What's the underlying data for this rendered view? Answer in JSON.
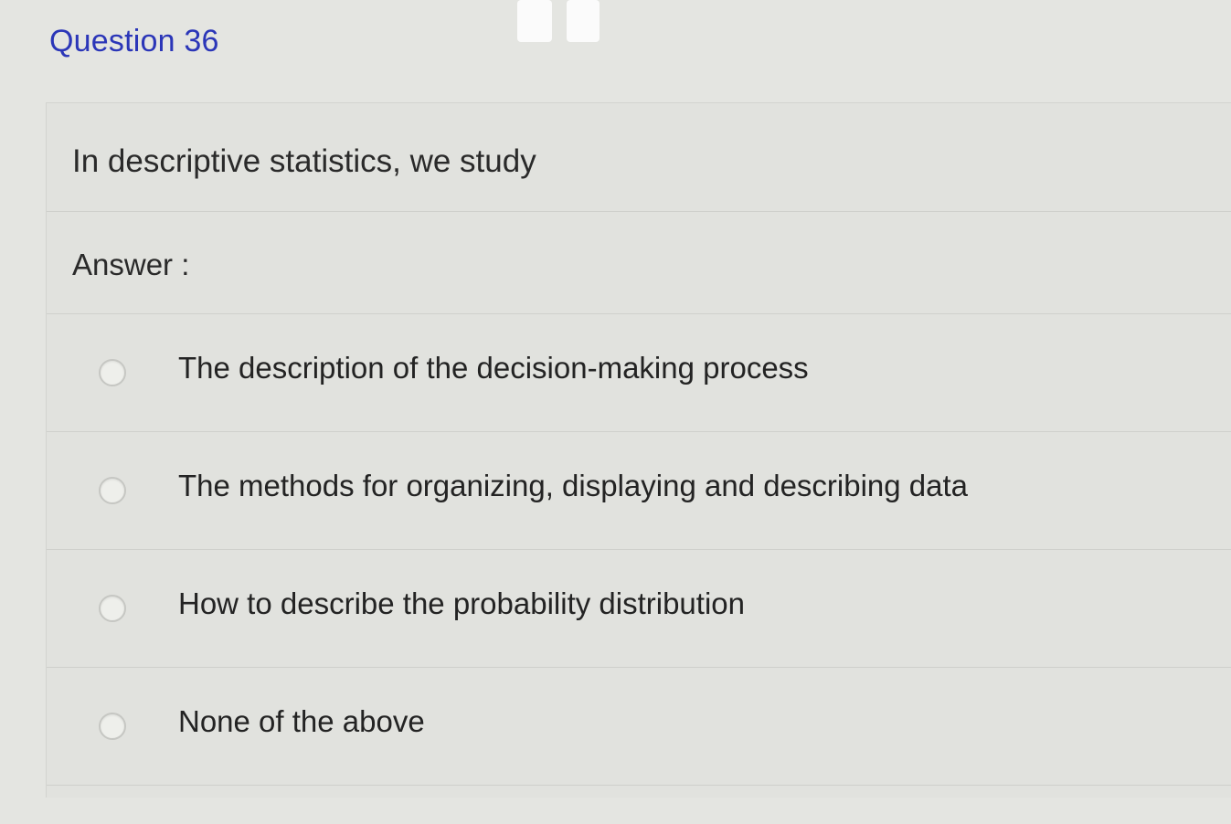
{
  "question": {
    "title": "Question 36",
    "prompt": "In descriptive statistics, we study",
    "answer_label": "Answer :"
  },
  "options": [
    {
      "label": "The description of the decision-making process",
      "selected": false
    },
    {
      "label": "The methods for organizing, displaying and describing data",
      "selected": false
    },
    {
      "label": "How to describe the probability distribution",
      "selected": false
    },
    {
      "label": "None of the above",
      "selected": false
    }
  ],
  "colors": {
    "title": "#2b36b8",
    "text": "#2a2a2a",
    "background": "#e4e5e1",
    "divider": "#cfd0cc"
  }
}
